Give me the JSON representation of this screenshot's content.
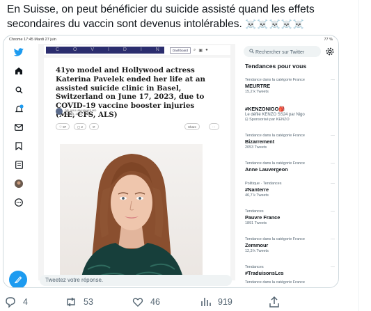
{
  "tweet": {
    "text": "En Suisse, on peut bénéficier du suicide assisté quand les effets secondaires du vaccin sont devenus intolérables.",
    "emoji": "☠️☠️☠️☠️☠️"
  },
  "screenshot": {
    "status_bar": {
      "left": "Chrome  17:45  Mardi 27 juin",
      "right": "77 %"
    },
    "site": {
      "logo_text": "C O V I D   I N T E L",
      "dashboard_label": "Dashboard",
      "headline": "41yo model and Hollywood actress Katerina Pavelek ended her life at an assisted suicide clinic in Basel, Switzerland on June 17, 2023, due to COVID-19 vaccine booster injuries (ME, CFS, ALS)",
      "byline_author": "DR. WILLIAM MAKIS MD",
      "byline_date": "JUN 25, 2023 · PAID",
      "likes": "97",
      "comments": "2",
      "share_label": "Share"
    },
    "reply_placeholder": "Tweetez votre réponse.",
    "search_placeholder": "Rechercher sur Twitter",
    "trends_title": "Tendances pour vous",
    "trends": [
      {
        "context": "Tendance dans la catégorie France",
        "name": "MEURTRE",
        "count": "15,2 k Tweets"
      },
      {
        "context": "",
        "name": "#KENZONIGO🎒",
        "count": "Le défilé KENZO SS24 par Nigo",
        "promo": "Sponsorisé par KENZO"
      },
      {
        "context": "Tendance dans la catégorie France",
        "name": "Bizarrement",
        "count": "2053 Tweets"
      },
      {
        "context": "Tendance dans la catégorie France",
        "name": "Anne Lauvergeon",
        "count": ""
      },
      {
        "context": "Politique · Tendances",
        "name": "#Nanterre",
        "count": "46,7 k Tweets"
      },
      {
        "context": "Tendances",
        "name": "Pauvre France",
        "count": "1891 Tweets"
      },
      {
        "context": "Tendance dans la catégorie France",
        "name": "Zemmour",
        "count": "12,3 k Tweets"
      },
      {
        "context": "Tendances",
        "name": "#TraduisonsLes",
        "count": ""
      },
      {
        "context": "Tendance dans la catégorie France",
        "name": "",
        "count": ""
      }
    ]
  },
  "actions": {
    "replies": "4",
    "retweets": "53",
    "likes": "46",
    "views": "919"
  }
}
